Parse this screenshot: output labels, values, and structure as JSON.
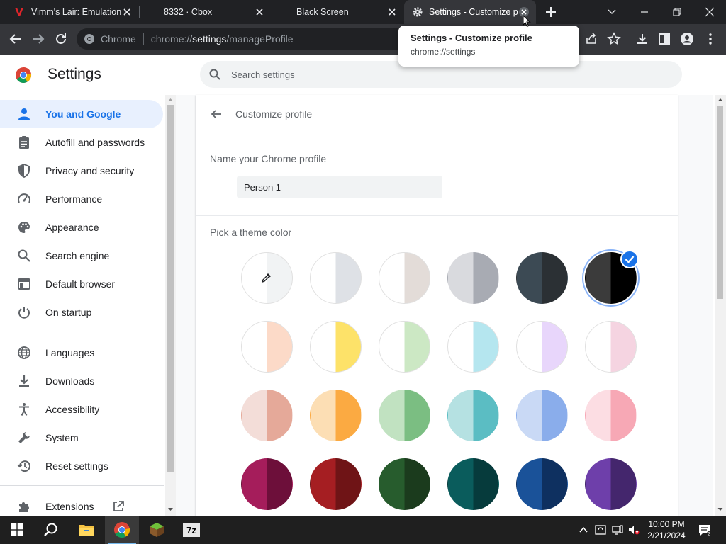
{
  "tabs": [
    {
      "title": "Vimm's Lair: Emulation",
      "icon": "vimm-icon"
    },
    {
      "title": "8332 · Cbox",
      "icon": "blank"
    },
    {
      "title": "Black Screen",
      "icon": "blank"
    },
    {
      "title": "Settings - Customize pr",
      "icon": "gear-icon",
      "active": true
    }
  ],
  "tooltip": {
    "title": "Settings - Customize profile",
    "url": "chrome://settings"
  },
  "omnibox": {
    "scheme_label": "Chrome",
    "url_prefix": "chrome://",
    "url_host": "settings",
    "url_path": "/manageProfile"
  },
  "header": {
    "title": "Settings",
    "search_placeholder": "Search settings"
  },
  "sidebar": {
    "items": [
      {
        "label": "You and Google",
        "icon": "person-icon",
        "selected": true
      },
      {
        "label": "Autofill and passwords",
        "icon": "clipboard-icon"
      },
      {
        "label": "Privacy and security",
        "icon": "shield-icon"
      },
      {
        "label": "Performance",
        "icon": "speedometer-icon"
      },
      {
        "label": "Appearance",
        "icon": "palette-icon"
      },
      {
        "label": "Search engine",
        "icon": "search-icon"
      },
      {
        "label": "Default browser",
        "icon": "browser-icon"
      },
      {
        "label": "On startup",
        "icon": "power-icon"
      },
      {
        "label": "Languages",
        "icon": "globe-icon"
      },
      {
        "label": "Downloads",
        "icon": "download-icon"
      },
      {
        "label": "Accessibility",
        "icon": "accessibility-icon"
      },
      {
        "label": "System",
        "icon": "wrench-icon"
      },
      {
        "label": "Reset settings",
        "icon": "restore-icon"
      },
      {
        "label": "Extensions",
        "icon": "puzzle-icon"
      }
    ]
  },
  "main": {
    "page_title": "Customize profile",
    "name_label": "Name your Chrome profile",
    "name_value": "Person 1",
    "theme_label": "Pick a theme color",
    "swatches": [
      {
        "left": "#ffffff",
        "right": "#f1f3f4",
        "eyedropper": true
      },
      {
        "left": "#ffffff",
        "right": "#dee1e6"
      },
      {
        "left": "#ffffff",
        "right": "#e3dcd8"
      },
      {
        "left": "#d9dade",
        "right": "#a8abb3"
      },
      {
        "left": "#3c4a54",
        "right": "#2b3034"
      },
      {
        "left": "#3b3b3b",
        "right": "#000000",
        "selected": true
      },
      {
        "left": "#ffffff",
        "right": "#fcdac8"
      },
      {
        "left": "#ffffff",
        "right": "#fde269"
      },
      {
        "left": "#ffffff",
        "right": "#cce8c4"
      },
      {
        "left": "#ffffff",
        "right": "#b5e6ef"
      },
      {
        "left": "#ffffff",
        "right": "#e8d6fb"
      },
      {
        "left": "#ffffff",
        "right": "#f5d4e1"
      },
      {
        "left": "#f3ddd8",
        "right": "#e5a999"
      },
      {
        "left": "#fcdeb4",
        "right": "#fbaa42"
      },
      {
        "left": "#c1e2c1",
        "right": "#7bbe82"
      },
      {
        "left": "#b5e1e2",
        "right": "#5bbdc3"
      },
      {
        "left": "#c9d9f5",
        "right": "#8aadeb"
      },
      {
        "left": "#fcdde3",
        "right": "#f7a8b5"
      },
      {
        "left": "#a51d5b",
        "right": "#6d0f3a"
      },
      {
        "left": "#a51e22",
        "right": "#6f1416"
      },
      {
        "left": "#275c2d",
        "right": "#1b3b1d"
      },
      {
        "left": "#0a5c5c",
        "right": "#063b3c"
      },
      {
        "left": "#1a5299",
        "right": "#0e3060"
      },
      {
        "left": "#6e3faa",
        "right": "#44266d"
      }
    ]
  },
  "taskbar": {
    "apps": [
      "start-icon",
      "search-icon",
      "file-explorer-icon",
      "chrome-icon",
      "minecraft-icon",
      "7zip-icon"
    ],
    "time": "10:00 PM",
    "date": "2/21/2024"
  }
}
